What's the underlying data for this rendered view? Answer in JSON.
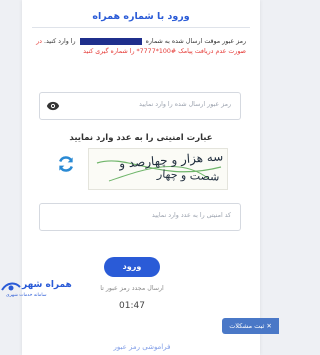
{
  "header": {
    "title": "ورود با شماره همراه"
  },
  "message": {
    "line1_before": "رمز عبور موقت ارسال شده به شماره",
    "line1_after": "را وارد کنید.",
    "line1_red": "در",
    "line2_red": "صورت عدم دریافت پیامک #100*7777* را شماره گیری کنید"
  },
  "password": {
    "placeholder": "رمز عبور ارسال شده را وارد نمایید"
  },
  "captcha": {
    "title": "عبارت امنیتی را به عدد وارد نمایید",
    "image_line1": "سه هزار و چهارصد و",
    "image_line2": "شصت و چهار"
  },
  "code": {
    "placeholder": "کد امنیتی را به عدد وارد نمایید"
  },
  "submit": {
    "label": "ورود"
  },
  "resend": {
    "label": "ارسال مجدد رمز عبور تا"
  },
  "timer": {
    "value": "01:47"
  },
  "forgot": {
    "label": "فراموشی رمز عبور"
  },
  "brand": {
    "name": "همراه شهر",
    "tagline": "سامانه خدمات شهری"
  },
  "support": {
    "label": "ثبت مشکلات"
  },
  "colors": {
    "accent": "#2a5bd7",
    "alert": "#e53935",
    "support": "#4a78c7"
  }
}
